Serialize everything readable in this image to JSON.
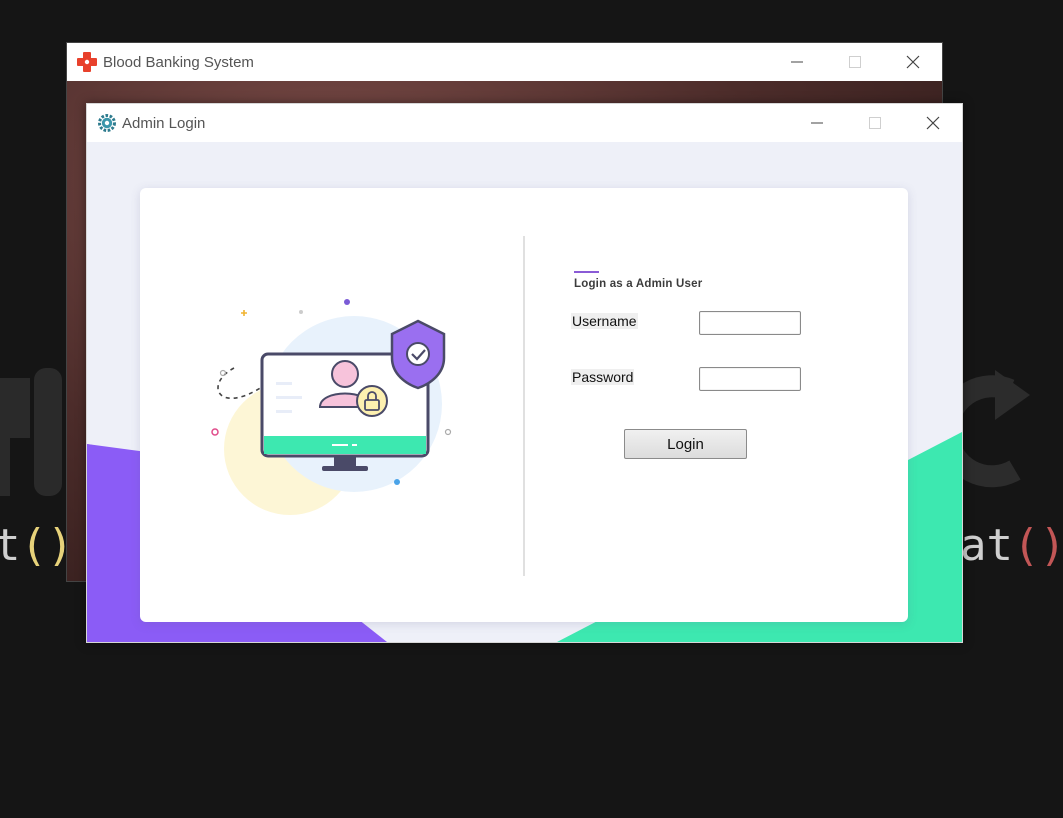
{
  "background": {
    "code_left": [
      "t",
      "(",
      ")"
    ],
    "code_right": [
      "at",
      "(",
      ")"
    ]
  },
  "main_window": {
    "title": "Blood Banking System",
    "icon": "red-cross-icon",
    "controls": [
      "minimize-icon",
      "maximize-icon",
      "close-icon"
    ]
  },
  "dialog": {
    "title": "Admin Login",
    "icon": "gear-icon",
    "heading": "Login as a Admin User",
    "username_label": "Username",
    "password_label": "Password",
    "username_value": "",
    "password_value": "",
    "login_button": "Login",
    "illustration": "computer-user-security-illustration"
  },
  "colors": {
    "accent_purple": "#8b5cf6",
    "accent_green": "#3de8b0",
    "brand_red": "#e8412c"
  }
}
